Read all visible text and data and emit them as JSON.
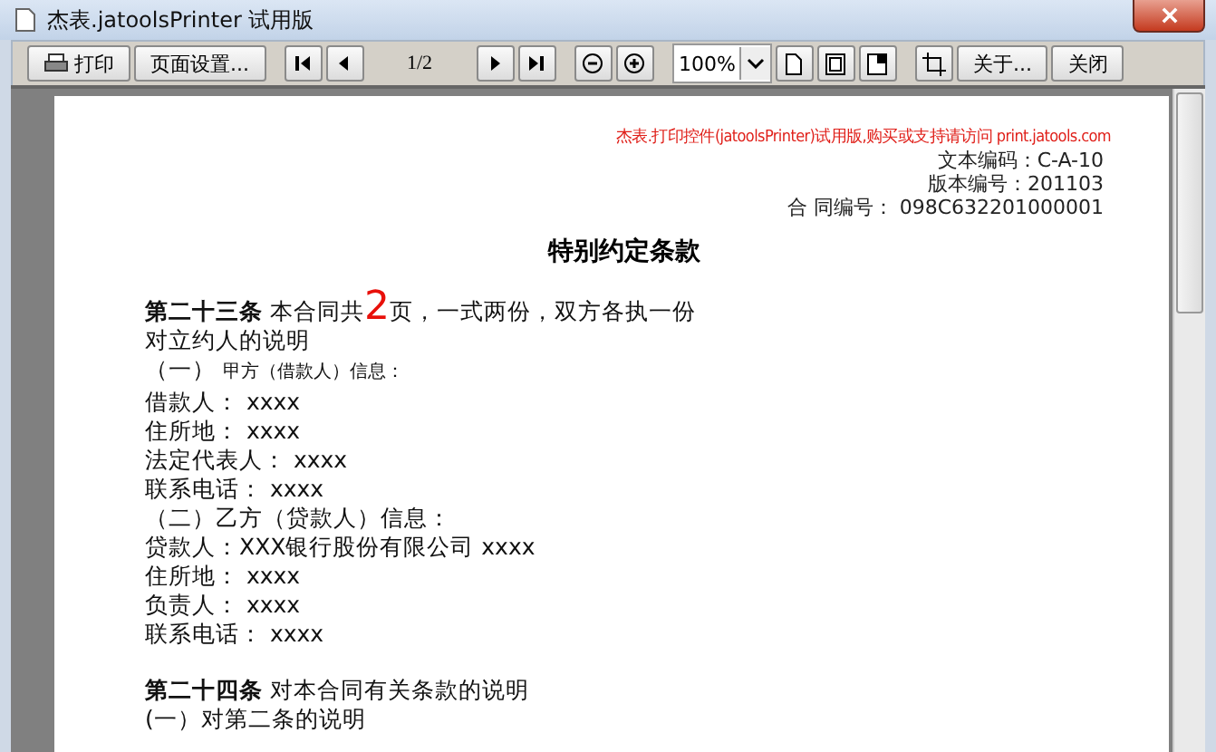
{
  "window": {
    "title": "杰表.jatoolsPrinter 试用版"
  },
  "toolbar": [
    {
      "kind": "print",
      "label": "打印"
    },
    {
      "kind": "button",
      "label": "页面设置..."
    },
    {
      "kind": "first"
    },
    {
      "kind": "prev"
    },
    {
      "kind": "page",
      "label": "1/2"
    },
    {
      "kind": "next"
    },
    {
      "kind": "last"
    },
    {
      "kind": "zoom-out"
    },
    {
      "kind": "zoom-in"
    },
    {
      "kind": "zoom",
      "label": "100%"
    },
    {
      "kind": "page-single"
    },
    {
      "kind": "page-fit"
    },
    {
      "kind": "page-width"
    },
    {
      "kind": "crop"
    },
    {
      "kind": "button",
      "label": "关于..."
    },
    {
      "kind": "button",
      "label": "关闭"
    }
  ],
  "document": {
    "notice": "杰表.打印控件(jatoolsPrinter)试用版,购买或支持请访问  print.jatools.com",
    "header_lines": [
      "文本编码：C-A-10",
      "版本编号：201103",
      "合 同编号：  098C632201000001"
    ],
    "title": "特别约定条款",
    "sections": [
      {
        "lines": [
          [
            {
              "kind": "article",
              "text": "第二十三条"
            },
            {
              "kind": "text",
              "text": "  本合同共"
            },
            {
              "kind": "page-count",
              "text": "2"
            },
            {
              "kind": "text",
              "text": "页，一式两份，双方各执一份"
            }
          ],
          [
            {
              "kind": "text",
              "text": "对立约人的说明"
            }
          ],
          [
            {
              "kind": "text",
              "text": "（一）  "
            },
            {
              "kind": "note",
              "text": "甲方（借款人）信息："
            }
          ],
          [
            {
              "kind": "text",
              "text": "借款人：  xxxx"
            }
          ],
          [
            {
              "kind": "text",
              "text": "住所地：  xxxx"
            }
          ],
          [
            {
              "kind": "text",
              "text": "法定代表人：  xxxx"
            }
          ],
          [
            {
              "kind": "text",
              "text": "联系电话：  xxxx"
            }
          ],
          [
            {
              "kind": "text",
              "text": "（二）乙方（贷款人）信息："
            }
          ],
          [
            {
              "kind": "text",
              "text": "贷款人：XXX银行股份有限公司 xxxx"
            }
          ],
          [
            {
              "kind": "text",
              "text": "住所地：  xxxx"
            }
          ],
          [
            {
              "kind": "text",
              "text": "负责人：  xxxx"
            }
          ],
          [
            {
              "kind": "text",
              "text": "联系电话：  xxxx"
            }
          ]
        ]
      },
      {
        "lines": [
          [
            {
              "kind": "article",
              "text": "第二十四条"
            },
            {
              "kind": "text",
              "text": "  对本合同有关条款的说明"
            }
          ],
          [
            {
              "kind": "text",
              "text": "(一）对第二条的说明"
            }
          ]
        ]
      }
    ]
  }
}
